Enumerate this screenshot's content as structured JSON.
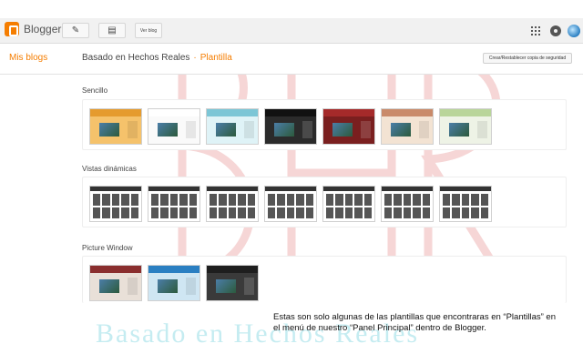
{
  "topbar": {
    "app_name": "Blogger",
    "view_blog_label": "Ver blog",
    "icons": [
      "blogger-logo-icon",
      "pencil-icon",
      "pages-icon",
      "apps-grid-icon",
      "notifications-icon",
      "account-avatar"
    ]
  },
  "subheader": {
    "my_blogs": "Mis blogs",
    "blog_name": "Basado en Hechos Reales",
    "separator": "·",
    "current_page": "Plantilla",
    "backup_button": "Crear/Restablecer copia de seguridad"
  },
  "sections": [
    {
      "title": "Sencillo"
    },
    {
      "title": "Vistas dinámicas"
    },
    {
      "title": "Picture Window"
    }
  ],
  "caption": "Estas son solo algunas de las plantillas que encontraras en “Plantillas” en el menú de nuestro “Panel Principal” dentro de Blogger.",
  "watermark_text": "Basado en Hechos Reales",
  "colors": {
    "accent": "#f57d00",
    "watermark_text": "#96dce6",
    "watermark_monogram": "#e06a6a"
  }
}
